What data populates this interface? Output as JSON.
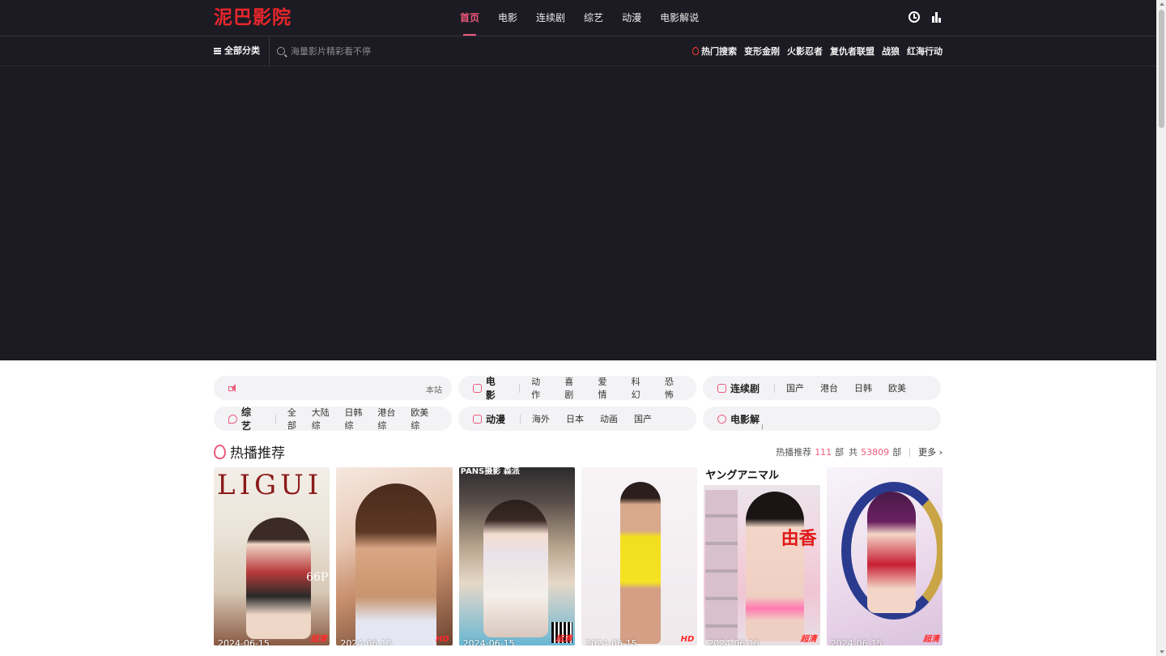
{
  "header": {
    "logo": "泥巴影院",
    "nav": [
      {
        "label": "首页",
        "active": true
      },
      {
        "label": "电影",
        "active": false
      },
      {
        "label": "连续剧",
        "active": false
      },
      {
        "label": "综艺",
        "active": false
      },
      {
        "label": "动漫",
        "active": false
      },
      {
        "label": "电影解说",
        "active": false
      }
    ],
    "icons": [
      "clock-icon",
      "chart-icon"
    ]
  },
  "subbar": {
    "category_label": "全部分类",
    "search_placeholder": "海量影片精彩看不停",
    "hot_label": "热门搜索",
    "hot_terms": [
      "变形金刚",
      "火影忍者",
      "复仇者联盟",
      "战狼",
      "红海行动"
    ]
  },
  "channels": {
    "notice_end": "本站",
    "movie": {
      "title": "电影",
      "links": [
        "动作",
        "喜剧",
        "爱情",
        "科幻",
        "恐怖"
      ]
    },
    "series": {
      "title": "连续剧",
      "links": [
        "国产",
        "港台",
        "日韩",
        "欧美"
      ]
    },
    "variety": {
      "title": "综艺",
      "links": [
        "全部",
        "大陆综",
        "日韩综",
        "港台综",
        "欧美综"
      ]
    },
    "anime": {
      "title": "动漫",
      "links": [
        "海外",
        "日本",
        "动画",
        "国产"
      ]
    },
    "commentary": {
      "title": "电影解"
    }
  },
  "section": {
    "title": "热播推荐",
    "meta_prefix": "热播推荐",
    "count": "111",
    "unit1": "部",
    "total_prefix": "共",
    "total": "53809",
    "unit2": "部",
    "more": "更多"
  },
  "cards": [
    {
      "date": "2024-06-15",
      "badge": "超清",
      "cover_text": "LIGUI",
      "cover_note": "66P"
    },
    {
      "date": "2024-06-15",
      "badge": "HD"
    },
    {
      "date": "2024-06-15",
      "badge": "超清",
      "cover_text": "PANS摄影 森派"
    },
    {
      "date": "2024-06-15",
      "badge": "HD"
    },
    {
      "date": "2024-06-15",
      "badge": "超清",
      "cover_text": "ヤングアニマル",
      "cover_note": "由香"
    },
    {
      "date": "2024-06-15",
      "badge": "超清"
    }
  ],
  "colors": {
    "accent": "#f0587b",
    "logo": "#e8262c",
    "header_bg": "#1c1b23"
  }
}
